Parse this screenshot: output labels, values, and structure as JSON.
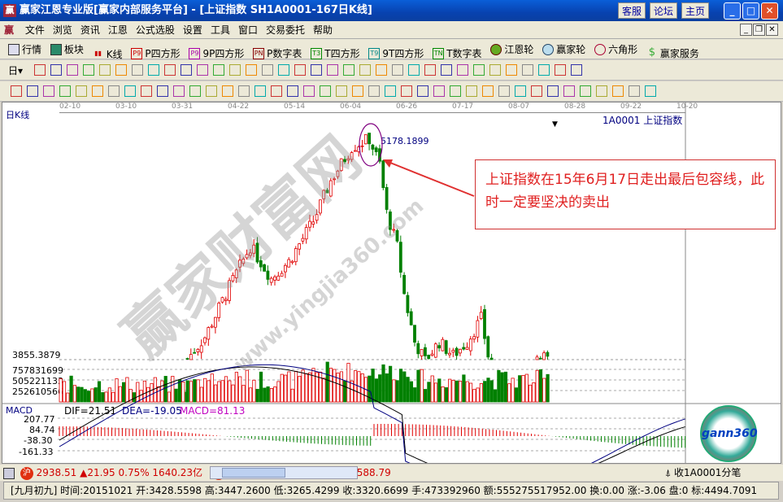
{
  "window": {
    "title": "赢家江恩专业版[赢家内部服务平台] - [上证指数   SH1A0001-167日K线]",
    "logo": "赢",
    "buttons": [
      "客服",
      "论坛",
      "主页"
    ]
  },
  "menu": {
    "logo": "赢",
    "items": [
      "文件",
      "浏览",
      "资讯",
      "江恩",
      "公式选股",
      "设置",
      "工具",
      "窗口",
      "交易委托",
      "帮助"
    ]
  },
  "toolbar": {
    "items": [
      {
        "icon": "grid-icon",
        "label": "行情"
      },
      {
        "icon": "blocks-icon",
        "label": "板块"
      },
      {
        "icon": "kline-icon",
        "label": "K线"
      },
      {
        "icon": "P9",
        "label": "P四方形"
      },
      {
        "icon": "P9",
        "label": "9P四方形"
      },
      {
        "icon": "PN",
        "label": "P数字表"
      },
      {
        "icon": "T3",
        "label": "T四方形"
      },
      {
        "icon": "T9",
        "label": "9T四方形"
      },
      {
        "icon": "TN",
        "label": "T数字表"
      },
      {
        "icon": "wheel-icon",
        "label": "江恩轮"
      },
      {
        "icon": "big-wheel-icon",
        "label": "赢家轮"
      },
      {
        "icon": "hexagon-icon",
        "label": "六角形"
      },
      {
        "icon": "dollar-icon",
        "label": "赢家服务"
      }
    ]
  },
  "toolbar2": {
    "period": "日"
  },
  "chart": {
    "period_label": "日K线",
    "dates": [
      "02-10",
      "03-10",
      "03-31",
      "04-22",
      "05-14",
      "06-04",
      "06-26",
      "07-17",
      "08-07",
      "08-28",
      "09-22",
      "10-20"
    ],
    "instrument": "1A0001  上证指数",
    "high_label": "5178.1899",
    "low_label": "3855.3879",
    "volume_ticks": [
      "757831699",
      "505221133",
      "252610566"
    ],
    "macd": {
      "title": "MACD",
      "dif": "DIF=21.51",
      "dea": "DEA=-19.05",
      "macd": "MACD=81.13",
      "ticks": [
        "207.77",
        "84.74",
        "-38.30",
        "-161.33"
      ]
    },
    "callout": "上证指数在15年6月17日走出最后包容线，此时一定要坚决的卖出",
    "watermark": "赢家财富网",
    "watermark_url": "www.yingjia360.com",
    "logo": "gann360",
    "colors": {
      "up": "#e00000",
      "down": "#008000",
      "dif": "#000000",
      "dea": "#000080",
      "macd": "#c000c0"
    }
  },
  "chart_data": {
    "type": "candlestick",
    "note_points_price": [
      [
        0,
        3860
      ],
      [
        5,
        3990
      ],
      [
        12,
        4290
      ],
      [
        18,
        4530
      ],
      [
        24,
        4340
      ],
      [
        29,
        4440
      ],
      [
        36,
        4680
      ],
      [
        41,
        4920
      ],
      [
        47,
        5120
      ],
      [
        52,
        5170
      ],
      [
        55,
        5020
      ],
      [
        57,
        4730
      ],
      [
        60,
        4530
      ],
      [
        62,
        4245
      ],
      [
        65,
        3960
      ],
      [
        68,
        3850
      ],
      [
        72,
        3960
      ],
      [
        76,
        3880
      ],
      [
        80,
        3960
      ],
      [
        84,
        4100
      ],
      [
        86,
        3880
      ],
      [
        90,
        3700
      ],
      [
        95,
        3600
      ],
      [
        99,
        3860
      ],
      [
        101,
        3900
      ],
      [
        103,
        3850
      ]
    ],
    "ylim": [
      3855.3879,
      5178.1899
    ]
  },
  "status1": {
    "sh_badge": "沪",
    "sh": "2938.51 ▲21.95 0.75% 1640.23亿",
    "sz_badge": "深",
    "sz": "10192.53 ▲80.96 0.80% 2588.79",
    "right": "收1A0001分笔"
  },
  "status2": {
    "text": "[九月初九] 时间:20151021 开:3428.5598 高:3447.2600 低:3265.4299 收:3320.6699 手:473392960 额:555275517952.00 换:0.00 涨:-3.06 盘:0 标:4494.7091"
  }
}
